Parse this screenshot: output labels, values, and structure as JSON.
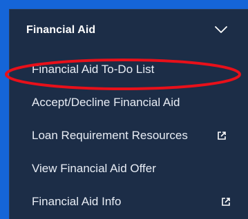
{
  "section": {
    "title": "Financial Aid",
    "expand_icon": "chevron-down-icon"
  },
  "menu": {
    "items": [
      {
        "label": "Financial Aid To-Do List",
        "external": false
      },
      {
        "label": "Accept/Decline Financial Aid",
        "external": false
      },
      {
        "label": "Loan Requirement Resources",
        "external": true,
        "icon": "external-link-icon"
      },
      {
        "label": "View Financial Aid Offer",
        "external": false
      },
      {
        "label": "Financial Aid Info",
        "external": true,
        "icon": "external-link-icon"
      }
    ]
  },
  "colors": {
    "outer_background": "#1565d8",
    "panel_background": "#1c2d47",
    "text": "#e8edf5",
    "highlight_ring": "#e8101a"
  }
}
